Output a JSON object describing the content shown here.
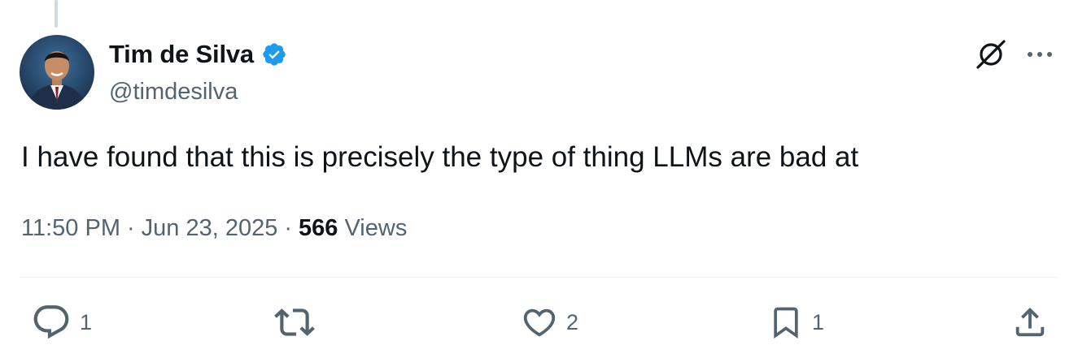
{
  "tweet": {
    "author": {
      "name": "Tim de Silva",
      "handle": "@timdesilva",
      "verified": true,
      "avatar": "profile-photo"
    },
    "text": "I have found that this is precisely the type of thing LLMs are bad at",
    "time": "11:50 PM",
    "separator": "·",
    "date": "Jun 23, 2025",
    "views_count": "566",
    "views_label": "Views"
  },
  "actions": {
    "reply": {
      "icon": "reply-icon",
      "count": "1"
    },
    "repost": {
      "icon": "repost-icon",
      "count": ""
    },
    "like": {
      "icon": "heart-icon",
      "count": "2"
    },
    "bookmark": {
      "icon": "bookmark-icon",
      "count": "1"
    },
    "share": {
      "icon": "share-icon",
      "count": ""
    }
  },
  "colors": {
    "text_primary": "#0f1419",
    "text_secondary": "#536471",
    "verified_blue": "#1d9bf0",
    "divider": "#eff3f4",
    "thread_line": "#cfd9de"
  }
}
